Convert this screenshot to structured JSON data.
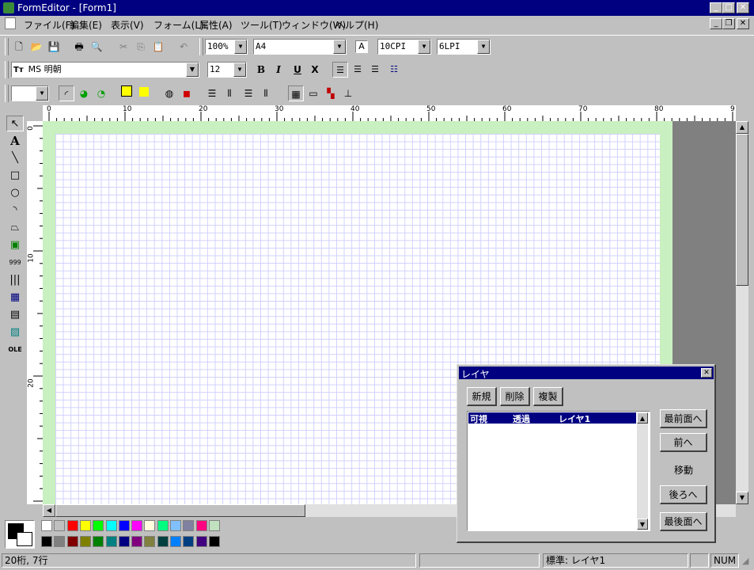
{
  "window": {
    "title": "FormEditor - [Form1]"
  },
  "menu": [
    "ファイル(F)",
    "編集(E)",
    "表示(V)",
    "フォーム(L)",
    "属性(A)",
    "ツール(T)",
    "ウィンドウ(W)",
    "ヘルプ(H)"
  ],
  "toolbar1": {
    "zoom": "100%",
    "paper": "A4",
    "cpi": "10CPI",
    "lpi": "6LPI",
    "font_glyph": "A"
  },
  "toolbar2": {
    "font_name": "MS 明朝",
    "font_size": "12",
    "bold": "B",
    "italic": "I",
    "underline": "U",
    "strike": "X"
  },
  "ruler": {
    "top_labels": [
      "0",
      "10",
      "20",
      "30",
      "40",
      "50",
      "60",
      "70",
      "80",
      "9"
    ],
    "left_labels": [
      "0",
      "10",
      "20"
    ]
  },
  "layer_dialog": {
    "title": "レイヤ",
    "new": "新規",
    "delete": "削除",
    "copy": "複製",
    "list_header": {
      "visible": "可視",
      "transparent": "透過",
      "name": "レイヤ1"
    },
    "front_most": "最前面へ",
    "forward": "前へ",
    "move": "移動",
    "backward": "後ろへ",
    "back_most": "最後面へ"
  },
  "palette": {
    "row1": [
      "#ffffff",
      "#c0c0c0",
      "#ff0000",
      "#ffff00",
      "#00ff00",
      "#00ffff",
      "#0000ff",
      "#ff00ff",
      "#ffffe0",
      "#00ff80",
      "#80c0ff",
      "#8080a0",
      "#ff0080",
      "#c0e0c0"
    ],
    "row2": [
      "#000000",
      "#808080",
      "#800000",
      "#808000",
      "#008000",
      "#008080",
      "#000080",
      "#800080",
      "#808040",
      "#004040",
      "#0080ff",
      "#004080",
      "#400080",
      "#000000"
    ]
  },
  "status": {
    "position": "20桁, 7行",
    "layer": "標準: レイヤ1",
    "num": "NUM"
  }
}
